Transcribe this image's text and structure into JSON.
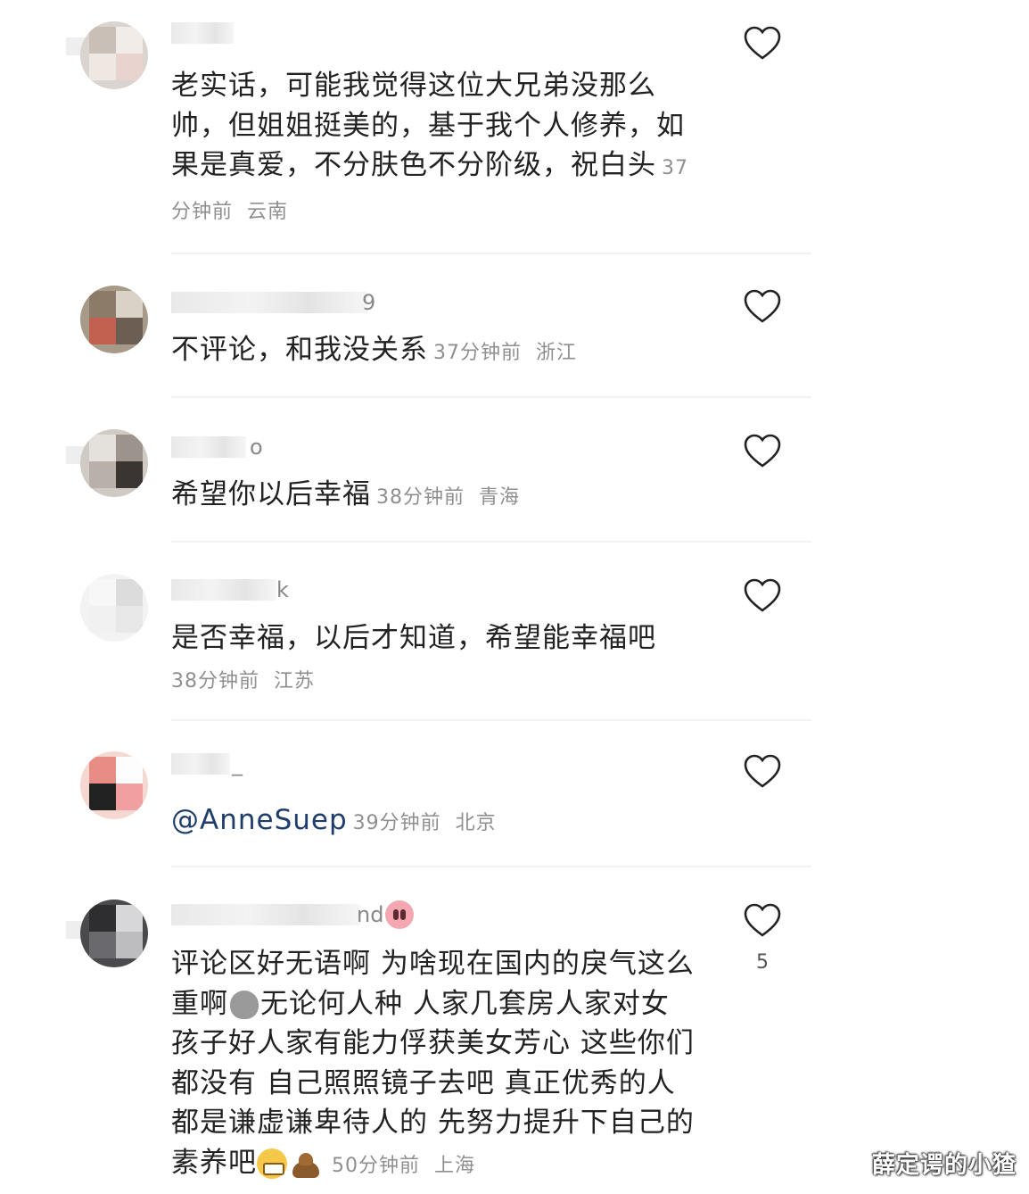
{
  "comments": [
    {
      "username_tail": "",
      "text": "老实话，可能我觉得这位大兄弟没那么帅，但姐姐挺美的，基于我个人修养，如果是真爱，不分肤色不分阶级，祝白头",
      "time": "37分钟前",
      "location": "云南"
    },
    {
      "username_tail": "9",
      "text": "不评论，和我没关系",
      "time": "37分钟前",
      "location": "浙江"
    },
    {
      "username_tail": "o",
      "text": "希望你以后幸福",
      "time": "38分钟前",
      "location": "青海"
    },
    {
      "username_tail": "k",
      "text": "是否幸福，以后才知道，希望能幸福吧",
      "time": "38分钟前",
      "location": "江苏"
    },
    {
      "username_tail": "_",
      "text": "@AnneSuep",
      "time": "39分钟前",
      "location": "北京"
    },
    {
      "username_tail": "nd",
      "text_part1": "评论区好无语啊 为啥现在国内的戾气这么重啊",
      "text_part2": "无论何人种 人家几套房人家对女孩子好人家有能力俘获美女芳心 这些你们都没有 自己照照镜子去吧 真正优秀的人都是谦虚谦卑待人的 先努力提升下自己的素养吧",
      "time": "50分钟前",
      "location": "上海",
      "likes": "5"
    }
  ],
  "icons": {
    "heart": "heart-outline-icon",
    "emoji_pig": "pig-emoji",
    "emoji_gray": "gray-face-emoji",
    "emoji_grin": "grinning-emoji",
    "emoji_poo": "poo-emoji"
  },
  "watermark": "薛定谔的小猹"
}
